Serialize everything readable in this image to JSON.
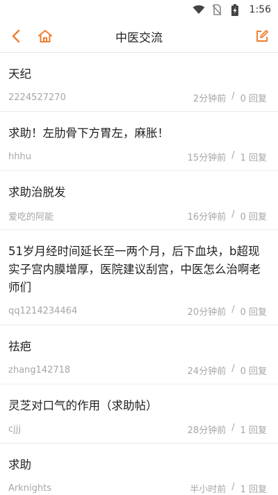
{
  "status_bar": {
    "time": "1:56",
    "icons": [
      "wifi-icon",
      "no-sim-icon",
      "battery-charging-icon"
    ]
  },
  "header": {
    "title": "中医交流",
    "back_icon": "chevron-left-icon",
    "home_icon": "home-icon",
    "edit_icon": "compose-icon",
    "accent_color": "#f07c2b"
  },
  "posts": [
    {
      "title": "天纪",
      "author": "2224527270",
      "time": "2分钟前",
      "sep": "/",
      "replies": "0 回复"
    },
    {
      "title": "求助！左肋骨下方胃左，麻胀！",
      "author": "hhhu",
      "time": "15分钟前",
      "sep": "/",
      "replies": "1 回复"
    },
    {
      "title": "求助治脱发",
      "author": "爱吃的阿能",
      "time": "16分钟前",
      "sep": "/",
      "replies": "0 回复"
    },
    {
      "title": "51岁月经时间延长至一两个月，后下血块，b超现实子宫内膜增厚，医院建议刮宫，中医怎么治啊老师们",
      "author": "qq1214234464",
      "time": "20分钟前",
      "sep": "/",
      "replies": "0 回复"
    },
    {
      "title": "祛疤",
      "author": "zhang142718",
      "time": "24分钟前",
      "sep": "/",
      "replies": "0 回复"
    },
    {
      "title": "灵芝对口气的作用（求助帖）",
      "author": "cjjj",
      "time": "28分钟前",
      "sep": "/",
      "replies": "1 回复"
    },
    {
      "title": "求助",
      "author": "Arknights",
      "time": "半小时前",
      "sep": "/",
      "replies": "1 回复"
    }
  ]
}
